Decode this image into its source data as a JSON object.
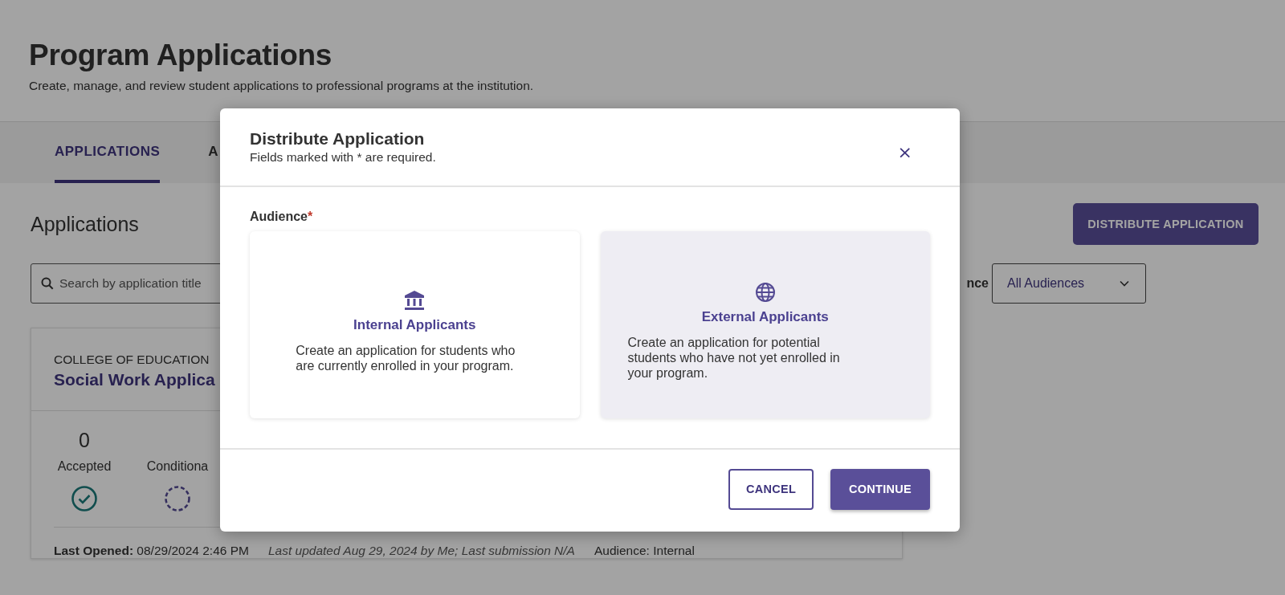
{
  "page": {
    "title": "Program Applications",
    "subtitle": "Create, manage, and review student applications to professional programs at the institution."
  },
  "tabs": [
    {
      "label": "APPLICATIONS",
      "selected": true
    },
    {
      "label": "A",
      "selected": false
    }
  ],
  "section": {
    "heading": "Applications",
    "distribute_button": "DISTRIBUTE APPLICATION",
    "search": {
      "placeholder": "Search by application title"
    },
    "filter": {
      "label": "nce",
      "value": "All Audiences"
    }
  },
  "application_card": {
    "college": "COLLEGE OF EDUCATION",
    "title": "Social Work Applica",
    "stats": [
      {
        "count": "0",
        "label": "Accepted",
        "kind": "accepted"
      },
      {
        "label": "Conditiona",
        "kind": "conditional"
      }
    ],
    "last_opened_label": "Last Opened:",
    "last_opened": "08/29/2024 2:46 PM",
    "updated": "Last updated Aug 29, 2024 by Me; Last submission N/A",
    "audience": "Audience: Internal"
  },
  "modal": {
    "title": "Distribute Application",
    "subtitle": "Fields marked with * are required.",
    "close": "×",
    "field_label": "Audience",
    "required_mark": "*",
    "options": [
      {
        "kind": "internal",
        "title": "Internal Applicants",
        "description": "Create an application for students who are currently enrolled in your program.",
        "selected": false
      },
      {
        "kind": "external",
        "title": "External Applicants",
        "description": "Create an application for potential students who have not yet enrolled in your program.",
        "selected": true
      }
    ],
    "buttons": [
      {
        "label": "CANCEL",
        "kind": "secondary"
      },
      {
        "label": "CONTINUE",
        "kind": "primary"
      }
    ]
  }
}
